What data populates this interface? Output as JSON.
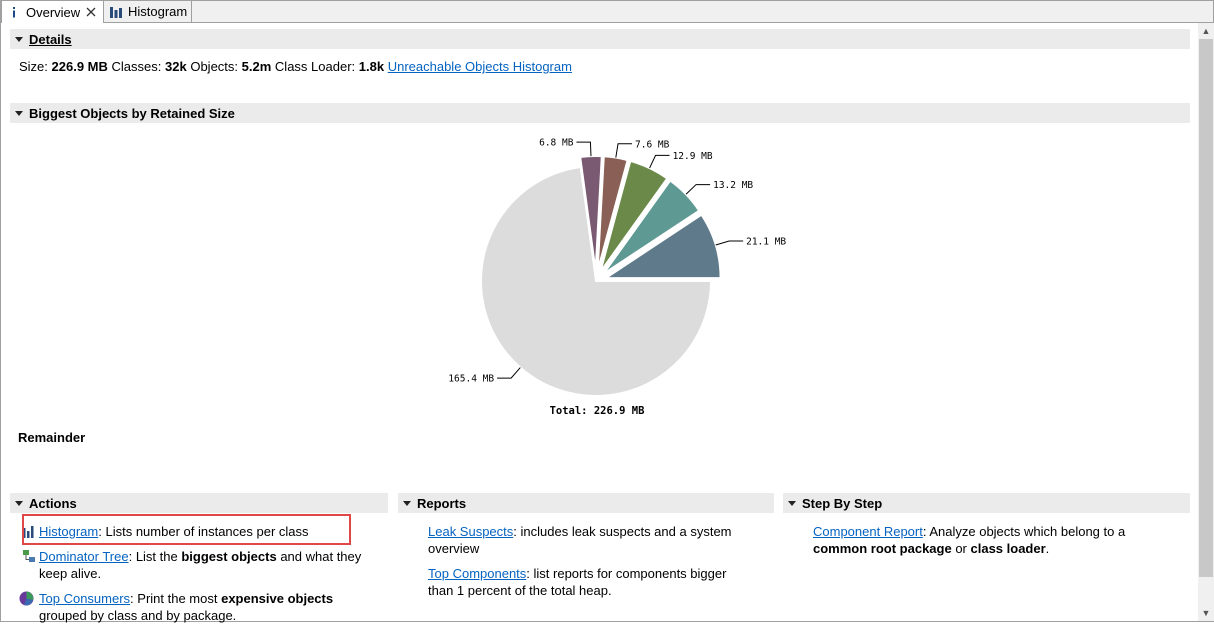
{
  "tabs": [
    {
      "label": "Overview",
      "icon": "info-icon",
      "active": true
    },
    {
      "label": "Histogram",
      "icon": "histogram-icon",
      "active": false
    }
  ],
  "details": {
    "heading": "Details",
    "size_label": "Size:",
    "size_value": "226.9 MB",
    "classes_label": "Classes:",
    "classes_value": "32k",
    "objects_label": "Objects:",
    "objects_value": "5.2m",
    "classloader_label": "Class Loader:",
    "classloader_value": "1.8k",
    "unreachable_link": "Unreachable Objects Histogram"
  },
  "biggest": {
    "heading": "Biggest Objects by Retained Size",
    "remainder_label": "Remainder"
  },
  "chart_data": {
    "type": "pie",
    "unit": "MB",
    "slices": [
      {
        "label": "21.1 MB",
        "value": 21.1,
        "color": "#5f7b8b"
      },
      {
        "label": "13.2 MB",
        "value": 13.2,
        "color": "#5e9994"
      },
      {
        "label": "12.9 MB",
        "value": 12.9,
        "color": "#6b8a4a"
      },
      {
        "label": "7.6 MB",
        "value": 7.6,
        "color": "#8a5f55"
      },
      {
        "label": "6.8 MB",
        "value": 6.8,
        "color": "#7a5a72"
      },
      {
        "label": "165.4 MB",
        "value": 165.4,
        "color": "#dcdcdc"
      }
    ],
    "total_label": "Total: 226.9 MB"
  },
  "actions": {
    "heading": "Actions",
    "items": [
      {
        "link": "Histogram",
        "text1": ": Lists number of instances per class",
        "bold1": "",
        "text2": "",
        "line2": ""
      },
      {
        "link": "Dominator Tree",
        "text1": ": List the ",
        "bold1": "biggest objects",
        "text2": " and what they",
        "line2": "keep alive."
      },
      {
        "link": "Top Consumers",
        "text1": ": Print the most ",
        "bold1": "expensive objects",
        "text2": "",
        "line2": "grouped by class and by package."
      }
    ]
  },
  "reports": {
    "heading": "Reports",
    "items": [
      {
        "link": "Leak Suspects",
        "text1": ": includes leak suspects and a system",
        "line2": "overview"
      },
      {
        "link": "Top Components",
        "text1": ": list reports for components bigger",
        "line2": "than 1 percent of the total heap."
      }
    ]
  },
  "stepbystep": {
    "heading": "Step By Step",
    "link": "Component Report",
    "text1": ": Analyze objects which belong to a",
    "bold1": "common root package",
    "mid": " or ",
    "bold2": "class loader",
    "end": "."
  }
}
